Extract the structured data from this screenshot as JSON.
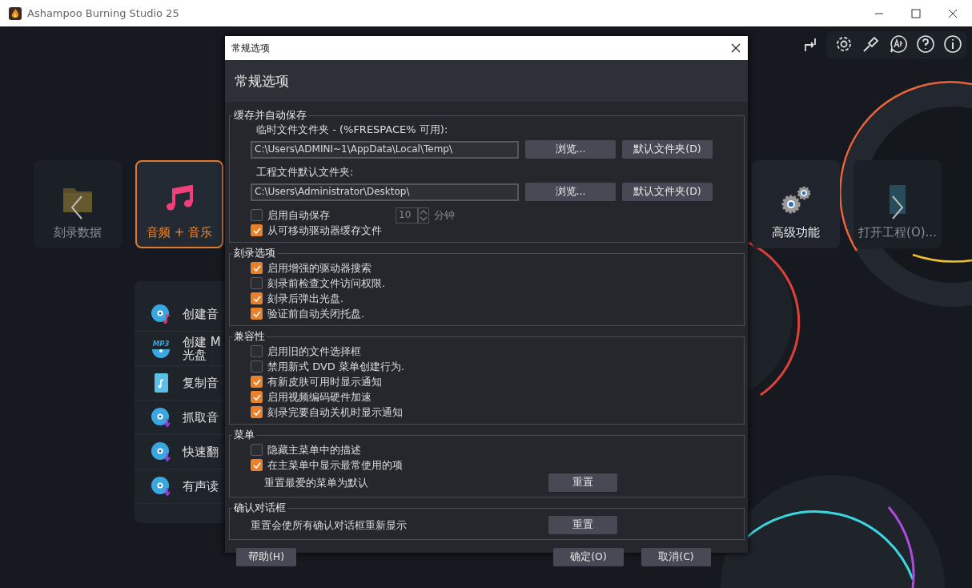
{
  "window": {
    "title": "Ashampoo Burning Studio 25"
  },
  "tiles_left": [
    {
      "label": "刻录数据",
      "kind": "folder",
      "selected": false,
      "dimmed": true
    },
    {
      "label": "音频 + 音乐",
      "kind": "music",
      "selected": true,
      "dimmed": false
    }
  ],
  "tiles_right": [
    {
      "label": "高级功能",
      "kind": "gears",
      "selected": false,
      "dimmed": false
    },
    {
      "label": "打开工程(O)...",
      "kind": "project",
      "selected": false,
      "dimmed": true
    }
  ],
  "audio_menu": [
    {
      "label": "创建音",
      "kind": "disc-note"
    },
    {
      "label": "创建 M",
      "label_2": "光盘",
      "kind": "mp3",
      "icon_text": "MP3"
    },
    {
      "label": "复制音",
      "kind": "note-file"
    },
    {
      "label": "抓取音",
      "kind": "disc-down"
    },
    {
      "label": "快速翻",
      "kind": "disc-down"
    },
    {
      "label": "有声读",
      "kind": "disc-down"
    }
  ],
  "dialog": {
    "title": "常规选项",
    "heading": "常规选项",
    "groups": [
      {
        "title": "缓存并自动保存",
        "rows": [
          {
            "kind": "folder",
            "label": "临时文件文件夹 - (%FRESPACE% 可用):",
            "path": "C:\\Users\\ADMINI~1\\AppData\\Local\\Temp\\",
            "buttons": [
              "浏览...",
              "默认文件夹(D)"
            ]
          },
          {
            "kind": "folder",
            "label": "工程文件默认文件夹:",
            "path": "C:\\Users\\Administrator\\Desktop\\",
            "buttons": [
              "浏览...",
              "默认文件夹(D)"
            ]
          },
          {
            "kind": "autosave",
            "label": "启用自动保存",
            "checked": false,
            "minutes": "10",
            "unit": "分钟",
            "disabled": true
          },
          {
            "kind": "checkbox",
            "label": "从可移动驱动器缓存文件",
            "checked": true
          }
        ]
      },
      {
        "title": "刻录选项",
        "rows": [
          {
            "kind": "checkbox",
            "label": "启用增强的驱动器搜索",
            "checked": true
          },
          {
            "kind": "checkbox",
            "label": "刻录前检查文件访问权限.",
            "checked": false
          },
          {
            "kind": "checkbox",
            "label": "刻录后弹出光盘.",
            "checked": true
          },
          {
            "kind": "checkbox",
            "label": "验证前自动关闭托盘.",
            "checked": true
          }
        ]
      },
      {
        "title": "兼容性",
        "rows": [
          {
            "kind": "checkbox",
            "label": "启用旧的文件选择框",
            "checked": false
          },
          {
            "kind": "checkbox",
            "label": "禁用新式 DVD 菜单创建行为.",
            "checked": false
          },
          {
            "kind": "checkbox",
            "label": "有新皮肤可用时显示通知",
            "checked": true
          },
          {
            "kind": "checkbox",
            "label": "启用视频编码硬件加速",
            "checked": true
          },
          {
            "kind": "checkbox",
            "label": "刻录完要自动关机时显示通知",
            "checked": true
          }
        ]
      },
      {
        "title": "菜单",
        "rows": [
          {
            "kind": "checkbox",
            "label": "隐藏主菜单中的描述",
            "checked": false
          },
          {
            "kind": "checkbox",
            "label": "在主菜单中显示最常使用的项",
            "checked": true
          },
          {
            "kind": "action",
            "label": "重置最爱的菜单为默认",
            "button": "重置",
            "indent": true
          }
        ]
      },
      {
        "title": "确认对话框",
        "rows": [
          {
            "kind": "action",
            "label": "重置会使所有确认对话框重新显示",
            "button": "重置",
            "indent": false
          }
        ]
      }
    ],
    "help_button": "帮助(H)",
    "ok_button": "确定(O)",
    "cancel_button": "取消(C)"
  }
}
